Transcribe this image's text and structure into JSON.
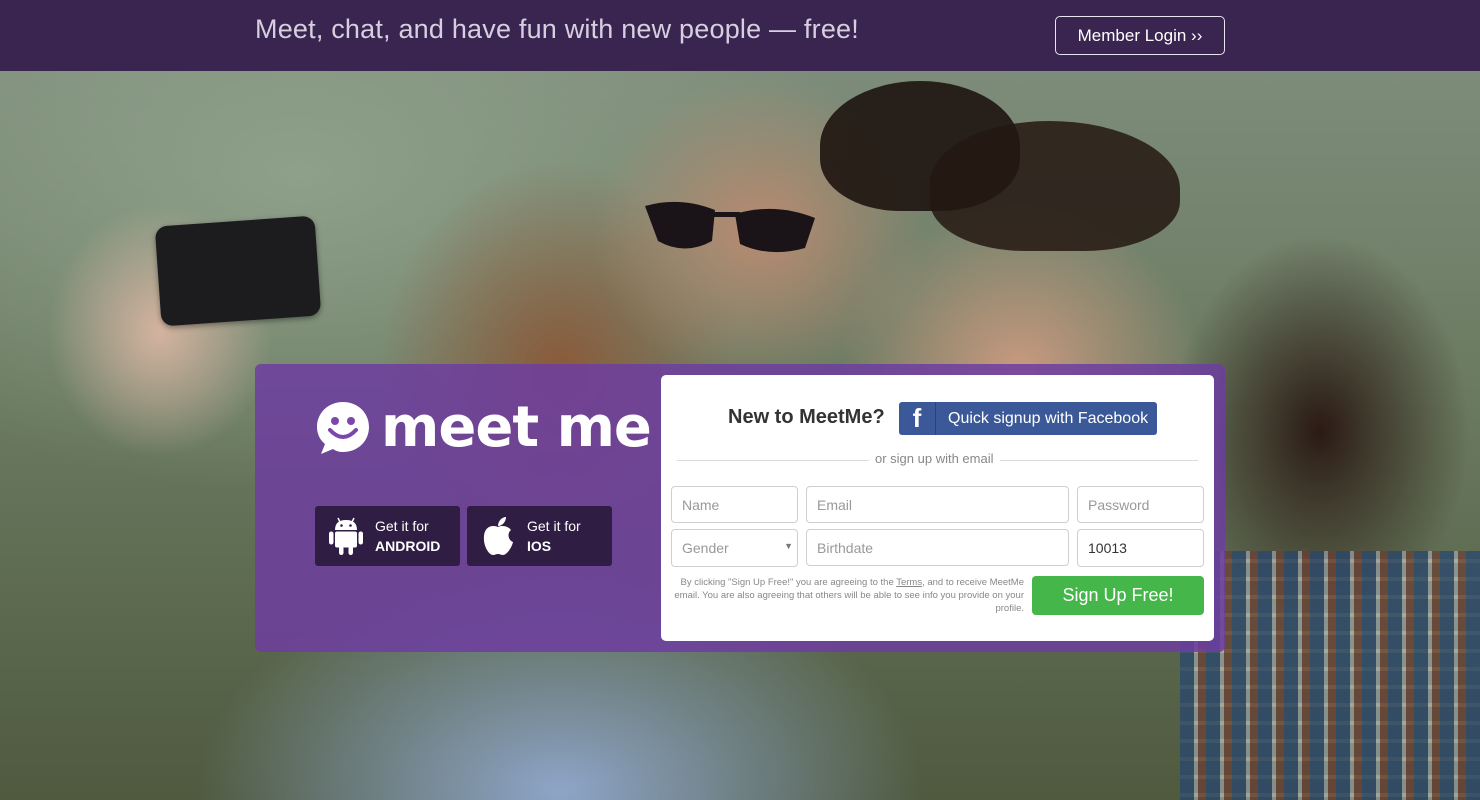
{
  "header": {
    "tagline": "Meet, chat, and have fun with new people — free!",
    "login_label": "Member Login ››"
  },
  "brand": {
    "logo_text": "meet me"
  },
  "apps": {
    "android": {
      "line1": "Get it for",
      "line2": "ANDROID"
    },
    "ios": {
      "line1": "Get it for",
      "line2": "IOS"
    }
  },
  "signup": {
    "heading": "New to MeetMe?",
    "facebook_label": "Quick signup with Facebook",
    "or_text": "or sign up with email",
    "fields": {
      "name_placeholder": "Name",
      "email_placeholder": "Email",
      "password_placeholder": "Password",
      "gender_placeholder": "Gender",
      "birthdate_placeholder": "Birthdate",
      "zip_value": "10013"
    },
    "terms_prefix": "By clicking \"Sign Up Free!\" you are agreeing to the ",
    "terms_link": "Terms",
    "terms_suffix": ", and to receive MeetMe email. You are also agreeing that others will be able to see info you provide on your profile.",
    "submit_label": "Sign Up Free!"
  },
  "colors": {
    "topbar": "#3a2551",
    "panel": "#6e3ea0",
    "facebook": "#3b5998",
    "signup_green": "#45b649"
  },
  "icons": {
    "logo": "smiley-chat-icon",
    "android": "android-icon",
    "ios": "apple-icon",
    "facebook": "facebook-icon"
  }
}
